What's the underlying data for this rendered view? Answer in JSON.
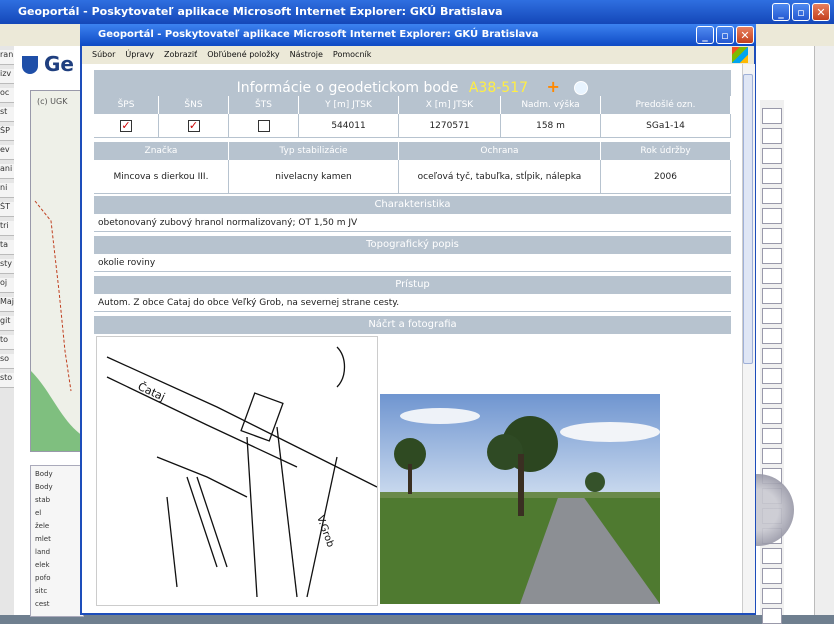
{
  "background_window": {
    "title": "Geoportál - Poskytovateľ aplikace Microsoft Internet Explorer: GKÚ Bratislava",
    "header_text": "Ge",
    "map_label": "(c) UGK",
    "legend_items": [
      "Body",
      "Body",
      "stab",
      "el",
      "žele",
      "mlet",
      "land",
      "elek",
      "pofo",
      "sitc",
      "cest"
    ],
    "left_labels": [
      "ran",
      "izv",
      "oc",
      "st",
      "ŠP",
      "ev",
      "ani",
      "ni",
      "ŠT",
      "tri",
      "ta",
      "sty",
      "oj",
      "Maj",
      "git",
      "to",
      "so",
      "sto"
    ]
  },
  "popup": {
    "title": "Geoportál - Poskytovateľ aplikace Microsoft Internet Explorer: GKÚ Bratislava",
    "menu": [
      "Súbor",
      "Úpravy",
      "Zobraziť",
      "Obľúbené položky",
      "Nástroje",
      "Pomocník"
    ],
    "info": {
      "heading": "Informácie o geodetickom bode",
      "point_id": "A38-517",
      "point_id_color": "#ffee44",
      "columns1": [
        "ŠPS",
        "ŠNS",
        "ŠTS",
        "Y [m] JTSK",
        "X [m] JTSK",
        "Nadm. výška",
        "Predošlé ozn."
      ],
      "row1": {
        "sps": true,
        "sns": true,
        "sts": false,
        "y": "544011",
        "x": "1270571",
        "height": "158 m",
        "prev": "SGa1-14"
      },
      "columns2": [
        "Značka",
        "Typ stabilizácie",
        "Ochrana",
        "Rok údržby"
      ],
      "row2": [
        "Mincova s dierkou III.",
        "nivelacny kamen",
        "oceľová tyč, tabuľka, stĺpik, nálepka",
        "2006"
      ],
      "charakteristika_label": "Charakteristika",
      "charakteristika": "obetonovaný zubový hranol normalizovaný; OT 1,50 m JV",
      "topo_label": "Topografický popis",
      "topo": "okolie roviny",
      "pristup_label": "Prístup",
      "pristup": "Autom. Z obce Cataj do obce Veľký Grob, na severnej strane cesty.",
      "sketch_label": "Náčrt a fotografia"
    }
  },
  "colors": {
    "header_bg": "#b7c3cf",
    "titlebar": "#1447b8",
    "accent_plus": "#ff8800"
  }
}
